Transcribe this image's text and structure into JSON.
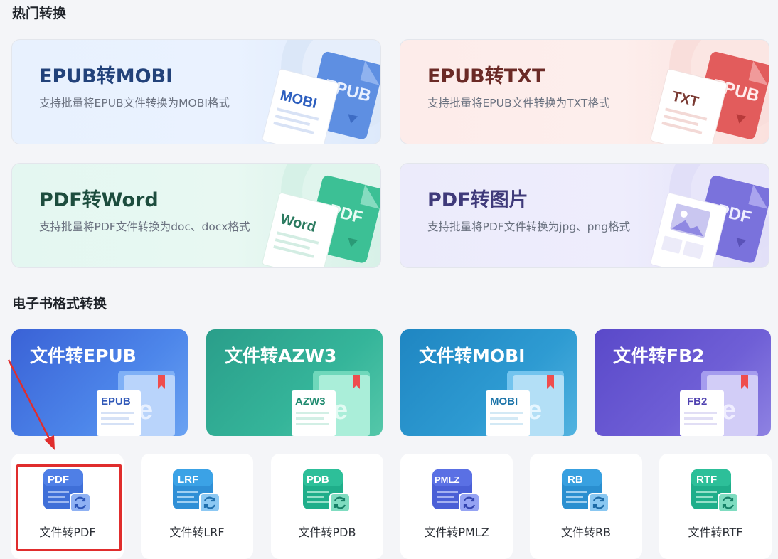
{
  "sections": {
    "hot": "热门转换",
    "ebook": "电子书格式转换"
  },
  "hot_cards": [
    {
      "title": "EPUB转MOBI",
      "subtitle": "支持批量将EPUB文件转换为MOBI格式",
      "front_label": "MOBI",
      "back_label": "EPUB"
    },
    {
      "title": "EPUB转TXT",
      "subtitle": "支持批量将EPUB文件转换为TXT格式",
      "front_label": "TXT",
      "back_label": "EPUB"
    },
    {
      "title": "PDF转Word",
      "subtitle": "支持批量将PDF文件转换为doc、docx格式",
      "front_label": "Word",
      "back_label": "PDF"
    },
    {
      "title": "PDF转图片",
      "subtitle": "支持批量将PDF文件转换为jpg、png格式",
      "front_label": "",
      "back_label": "PDF"
    }
  ],
  "ebook_cards": [
    {
      "title": "文件转EPUB",
      "label": "EPUB"
    },
    {
      "title": "文件转AZW3",
      "label": "AZW3"
    },
    {
      "title": "文件转MOBI",
      "label": "MOBI"
    },
    {
      "title": "文件转FB2",
      "label": "FB2"
    }
  ],
  "format_cards": [
    {
      "label": "文件转PDF",
      "icon_text": "PDF"
    },
    {
      "label": "文件转LRF",
      "icon_text": "LRF"
    },
    {
      "label": "文件转PDB",
      "icon_text": "PDB"
    },
    {
      "label": "文件转PMLZ",
      "icon_text": "PMLZ"
    },
    {
      "label": "文件转RB",
      "icon_text": "RB"
    },
    {
      "label": "文件转RTF",
      "icon_text": "RTF"
    }
  ],
  "colors": {
    "accent_blue": "#4a7fe0",
    "accent_red": "#e04b4b",
    "accent_green": "#2fb58a",
    "accent_purple": "#6f64d8",
    "highlight": "#e02d2d"
  }
}
